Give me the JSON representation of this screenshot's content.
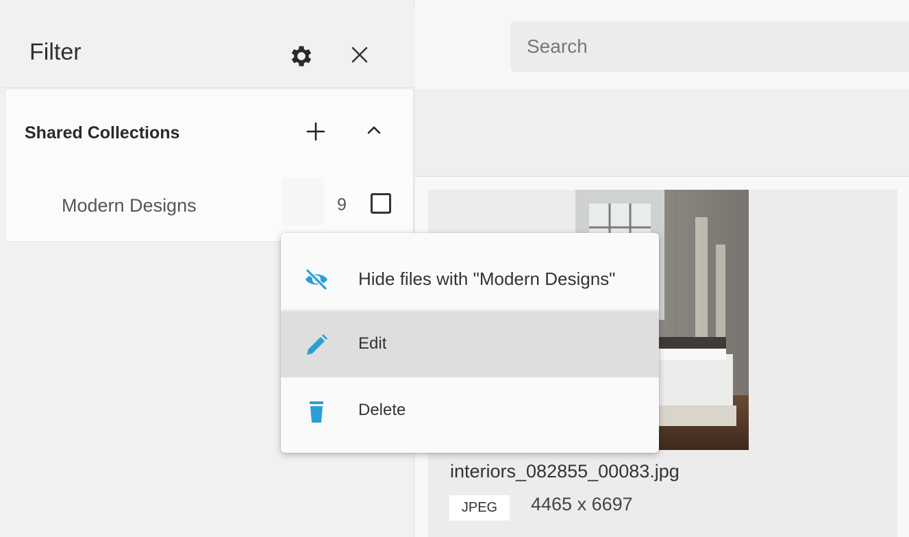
{
  "sidebar": {
    "title": "Filter",
    "collections": {
      "title": "Shared Collections",
      "items": [
        {
          "label": "Modern Designs",
          "count": "9",
          "checked": false
        }
      ]
    }
  },
  "search": {
    "placeholder": "Search"
  },
  "file": {
    "name": "interiors_082855_00083.jpg",
    "type": "JPEG",
    "dimensions": "4465 x 6697"
  },
  "context_menu": {
    "items": [
      {
        "label": "Hide files with \"Modern Designs\"",
        "icon": "eye-off-icon"
      },
      {
        "label": "Edit",
        "icon": "pencil-icon",
        "highlighted": true
      },
      {
        "label": "Delete",
        "icon": "trash-icon"
      }
    ]
  },
  "colors": {
    "accent": "#2a9fd6",
    "menu_highlight": "#dedede",
    "sidebar_bg": "#f1f1f1"
  }
}
